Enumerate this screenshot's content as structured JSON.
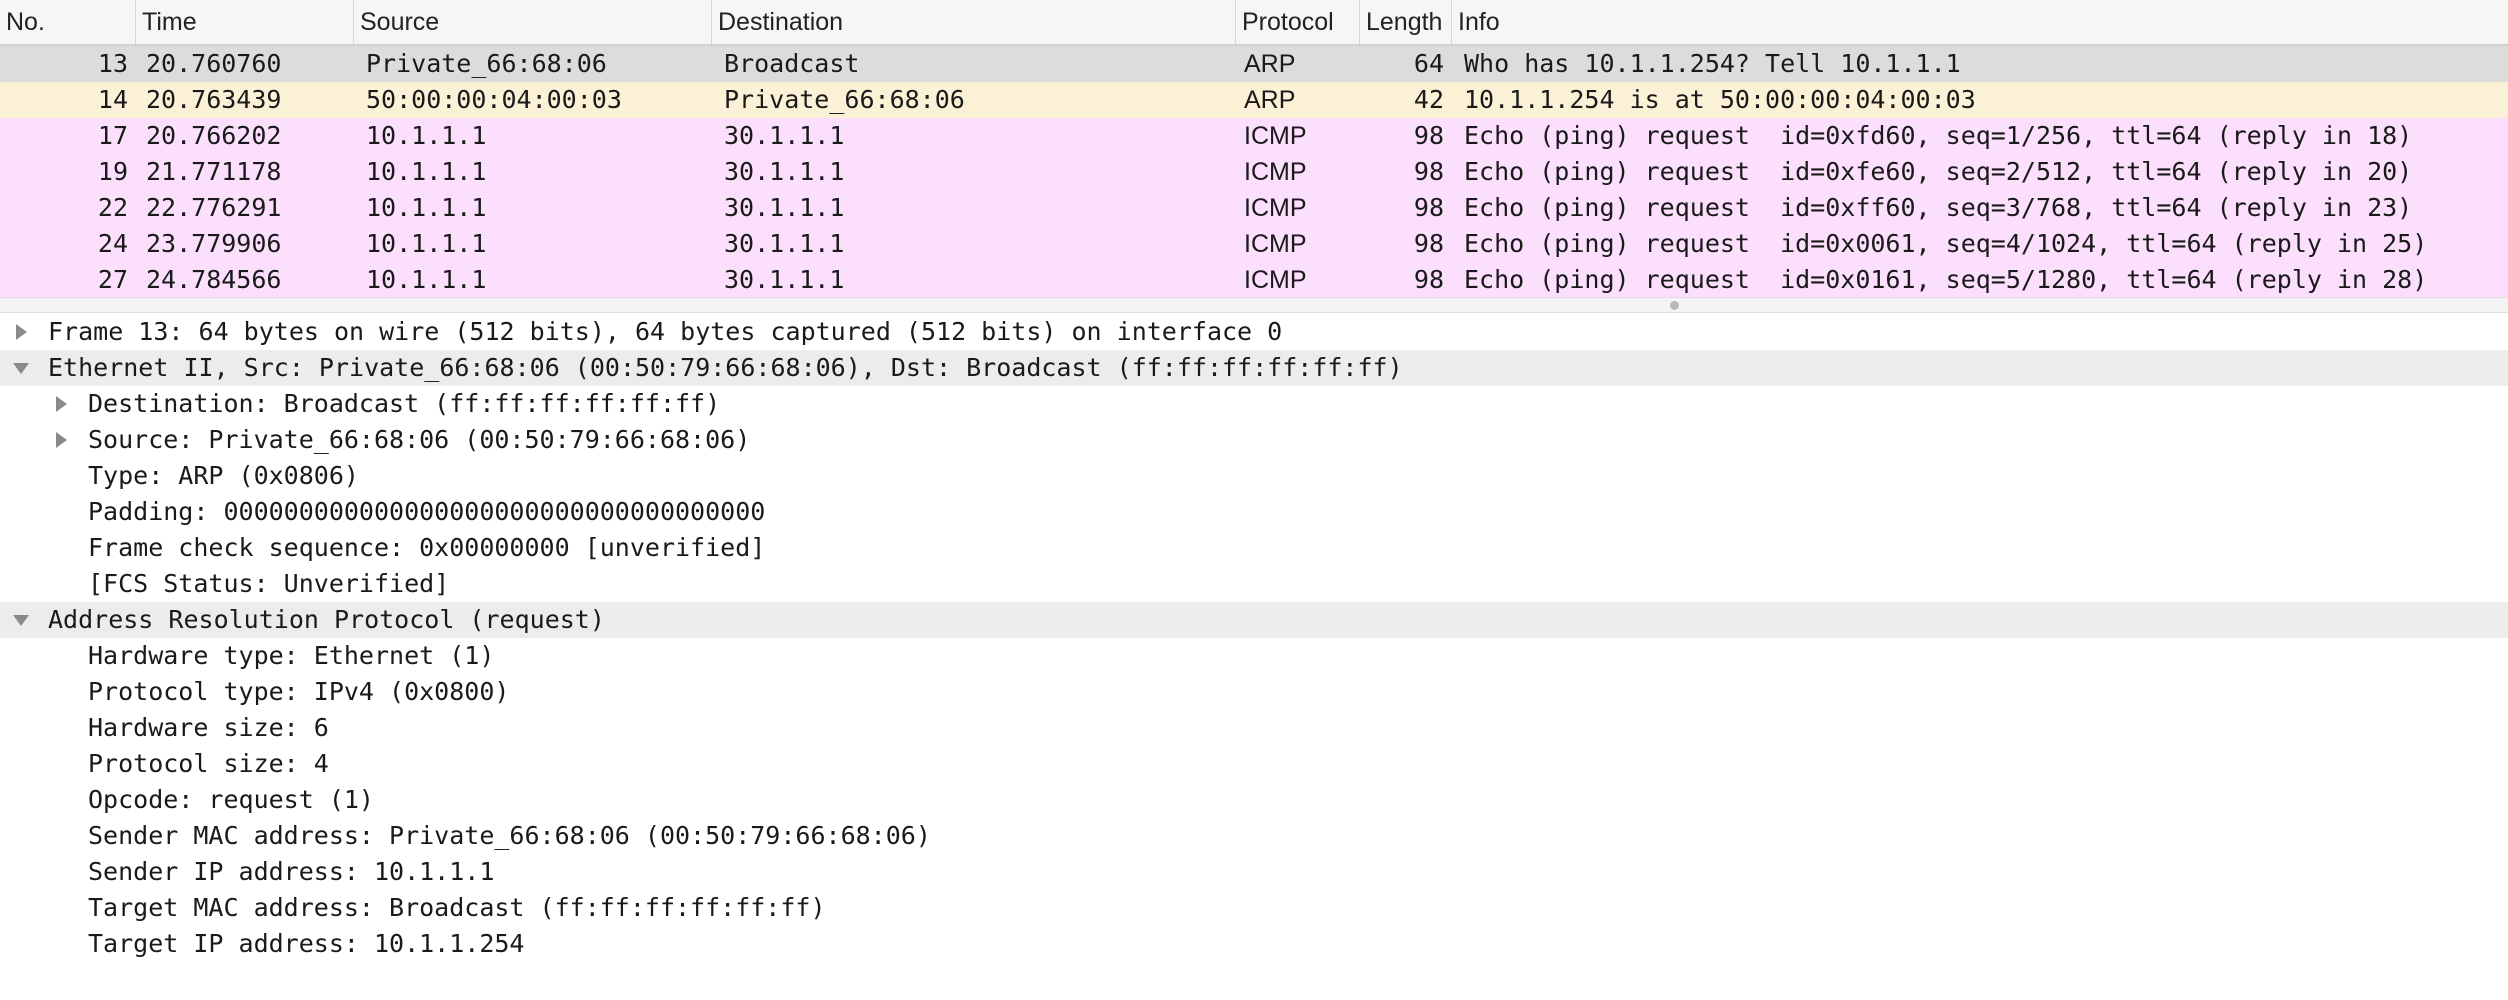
{
  "columns": [
    "No.",
    "Time",
    "Source",
    "Destination",
    "Protocol",
    "Length",
    "Info"
  ],
  "colors": {
    "selected_row": "#dcdcdc",
    "arp_row": "#fbf1d7",
    "icmp_row": "#fcdffc",
    "section_bg": "#ececec",
    "triangle": "#8a8a8a"
  },
  "packets": [
    {
      "no": "13",
      "time": "20.760760",
      "source": "Private_66:68:06",
      "destination": "Broadcast",
      "protocol": "ARP",
      "length": "64",
      "info": "Who has 10.1.1.254? Tell 10.1.1.1",
      "style": "selected"
    },
    {
      "no": "14",
      "time": "20.763439",
      "source": "50:00:00:04:00:03",
      "destination": "Private_66:68:06",
      "protocol": "ARP",
      "length": "42",
      "info": "10.1.1.254 is at 50:00:00:04:00:03",
      "style": "arp"
    },
    {
      "no": "17",
      "time": "20.766202",
      "source": "10.1.1.1",
      "destination": "30.1.1.1",
      "protocol": "ICMP",
      "length": "98",
      "info": "Echo (ping) request  id=0xfd60, seq=1/256, ttl=64 (reply in 18)",
      "style": "icmp"
    },
    {
      "no": "19",
      "time": "21.771178",
      "source": "10.1.1.1",
      "destination": "30.1.1.1",
      "protocol": "ICMP",
      "length": "98",
      "info": "Echo (ping) request  id=0xfe60, seq=2/512, ttl=64 (reply in 20)",
      "style": "icmp"
    },
    {
      "no": "22",
      "time": "22.776291",
      "source": "10.1.1.1",
      "destination": "30.1.1.1",
      "protocol": "ICMP",
      "length": "98",
      "info": "Echo (ping) request  id=0xff60, seq=3/768, ttl=64 (reply in 23)",
      "style": "icmp"
    },
    {
      "no": "24",
      "time": "23.779906",
      "source": "10.1.1.1",
      "destination": "30.1.1.1",
      "protocol": "ICMP",
      "length": "98",
      "info": "Echo (ping) request  id=0x0061, seq=4/1024, ttl=64 (reply in 25)",
      "style": "icmp"
    },
    {
      "no": "27",
      "time": "24.784566",
      "source": "10.1.1.1",
      "destination": "30.1.1.1",
      "protocol": "ICMP",
      "length": "98",
      "info": "Echo (ping) request  id=0x0161, seq=5/1280, ttl=64 (reply in 28)",
      "style": "icmp"
    }
  ],
  "details": [
    {
      "text": "Frame 13: 64 bytes on wire (512 bits), 64 bytes captured (512 bits) on interface 0",
      "level": 0,
      "toggle": "collapsed",
      "highlight": false
    },
    {
      "text": "Ethernet II, Src: Private_66:68:06 (00:50:79:66:68:06), Dst: Broadcast (ff:ff:ff:ff:ff:ff)",
      "level": 0,
      "toggle": "expanded",
      "highlight": true
    },
    {
      "text": "Destination: Broadcast (ff:ff:ff:ff:ff:ff)",
      "level": 1,
      "toggle": "collapsed",
      "highlight": false
    },
    {
      "text": "Source: Private_66:68:06 (00:50:79:66:68:06)",
      "level": 1,
      "toggle": "collapsed",
      "highlight": false
    },
    {
      "text": "Type: ARP (0x0806)",
      "level": 1,
      "toggle": "none",
      "highlight": false
    },
    {
      "text": "Padding: 000000000000000000000000000000000000",
      "level": 1,
      "toggle": "none",
      "highlight": false
    },
    {
      "text": "Frame check sequence: 0x00000000 [unverified]",
      "level": 1,
      "toggle": "none",
      "highlight": false
    },
    {
      "text": "[FCS Status: Unverified]",
      "level": 1,
      "toggle": "none",
      "highlight": false
    },
    {
      "text": "Address Resolution Protocol (request)",
      "level": 0,
      "toggle": "expanded",
      "highlight": true
    },
    {
      "text": "Hardware type: Ethernet (1)",
      "level": 1,
      "toggle": "none",
      "highlight": false
    },
    {
      "text": "Protocol type: IPv4 (0x0800)",
      "level": 1,
      "toggle": "none",
      "highlight": false
    },
    {
      "text": "Hardware size: 6",
      "level": 1,
      "toggle": "none",
      "highlight": false
    },
    {
      "text": "Protocol size: 4",
      "level": 1,
      "toggle": "none",
      "highlight": false
    },
    {
      "text": "Opcode: request (1)",
      "level": 1,
      "toggle": "none",
      "highlight": false
    },
    {
      "text": "Sender MAC address: Private_66:68:06 (00:50:79:66:68:06)",
      "level": 1,
      "toggle": "none",
      "highlight": false
    },
    {
      "text": "Sender IP address: 10.1.1.1",
      "level": 1,
      "toggle": "none",
      "highlight": false
    },
    {
      "text": "Target MAC address: Broadcast (ff:ff:ff:ff:ff:ff)",
      "level": 1,
      "toggle": "none",
      "highlight": false
    },
    {
      "text": "Target IP address: 10.1.1.254",
      "level": 1,
      "toggle": "none",
      "highlight": false
    }
  ]
}
